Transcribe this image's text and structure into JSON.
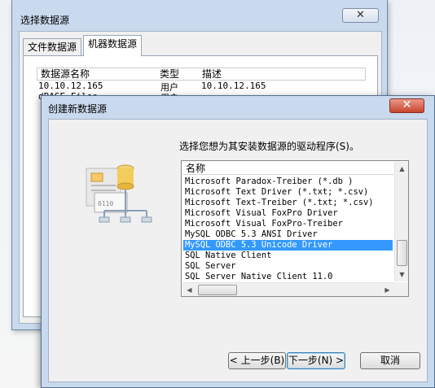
{
  "back_dialog": {
    "title": "选择数据源",
    "close_symbol": "✕",
    "tabs": [
      {
        "label": "文件数据源"
      },
      {
        "label": "机器数据源"
      }
    ],
    "columns": {
      "name": "数据源名称",
      "type": "类型",
      "desc": "描述"
    },
    "rows": [
      {
        "name": "10.10.12.165",
        "type": "用户",
        "desc": "10.10.12.165"
      },
      {
        "name": "dBASE Files",
        "type": "用户",
        "desc": ""
      }
    ]
  },
  "front_dialog": {
    "title": "创建新数据源",
    "close_symbol": "✕",
    "prompt": "选择您想为其安装数据源的驱动程序(S)。",
    "list_header": "名称",
    "drivers": [
      "Microsoft Paradox-Treiber (*.db )",
      "Microsoft Text Driver (*.txt; *.csv)",
      "Microsoft Text-Treiber (*.txt; *.csv)",
      "Microsoft Visual FoxPro Driver",
      "Microsoft Visual FoxPro-Treiber",
      "MySQL ODBC 5.3 ANSI Driver",
      "MySQL ODBC 5.3 Unicode Driver",
      "SQL Native Client",
      "SQL Server",
      "SQL Server Native Client 11.0"
    ],
    "selected_index": 6,
    "buttons": {
      "back": "< 上一步(B)",
      "next": "下一步(N) >",
      "cancel": "取消"
    }
  },
  "colors": {
    "selection": "#3399ff",
    "window_frame": "#c9daee",
    "close_red": "#c8452e"
  }
}
